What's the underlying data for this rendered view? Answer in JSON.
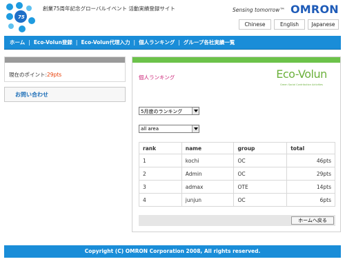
{
  "header": {
    "site_title": "創業75周年記念グローバルイベント 活動実績登録サイト",
    "tagline": "Sensing tomorrow™",
    "brand": "OMRON",
    "logo_icon": "anniversary-75-logo",
    "languages": [
      "Chinese",
      "English",
      "Japanese"
    ]
  },
  "nav": {
    "items": [
      "ホーム",
      "Eco-Volun登録",
      "Eco-Volun代理入力",
      "個人ランキング",
      "グループ各社実績一覧"
    ],
    "separator": "|"
  },
  "sidebar": {
    "points_label": "現在のポイント:",
    "points_value": "29pts",
    "contact_label": "お問い合わせ"
  },
  "main": {
    "title": "個人ランキング",
    "eco_logo_text": "Eco-Volun",
    "eco_logo_sub": "Green Social Contribution Activities",
    "month_select": "5月度のランキング",
    "area_select": "all area",
    "table": {
      "headers": [
        "rank",
        "name",
        "group",
        "total"
      ],
      "rows": [
        [
          "1",
          "kochi",
          "OC",
          "46pts"
        ],
        [
          "2",
          "Admin",
          "OC",
          "29pts"
        ],
        [
          "3",
          "admax",
          "OTE",
          "14pts"
        ],
        [
          "4",
          "junjun",
          "OC",
          "6pts"
        ]
      ]
    },
    "home_button": "ホームへ戻る"
  },
  "footer": {
    "copyright": "Copyright (C) OMRON Corporation 2008, All rights reserved."
  },
  "colors": {
    "nav_blue": "#1A8DD8",
    "brand_blue": "#1E5BB8",
    "eco_green": "#6CC24A",
    "points_red": "#E83A00",
    "title_pink": "#CC2277"
  }
}
